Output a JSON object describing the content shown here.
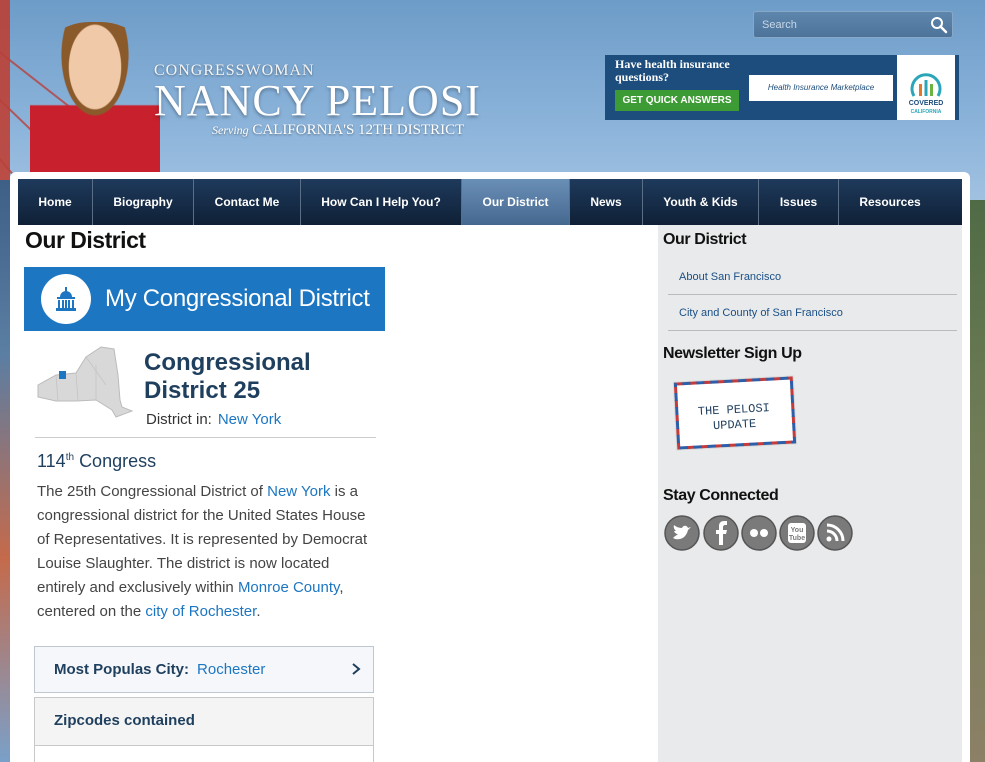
{
  "header": {
    "title_small": "CONGRESSWOMAN",
    "title_big": "NANCY PELOSI",
    "serving": "Serving",
    "district_line": "CALIFORNIA'S 12TH DISTRICT",
    "search_placeholder": "Search"
  },
  "banner": {
    "question": "Have health insurance questions?",
    "cta": "GET QUICK ANSWERS",
    "marketplace": "Health Insurance Marketplace",
    "covered_1": "COVERED",
    "covered_2": "CALIFORNIA"
  },
  "nav": [
    {
      "label": "Home"
    },
    {
      "label": "Biography"
    },
    {
      "label": "Contact Me"
    },
    {
      "label": "How Can I Help You?"
    },
    {
      "label": "Our District"
    },
    {
      "label": "News"
    },
    {
      "label": "Youth & Kids"
    },
    {
      "label": "Issues"
    },
    {
      "label": "Resources"
    }
  ],
  "main": {
    "page_title": "Our District",
    "header_label": "My Congressional District",
    "cd_title": "Congressional District 25",
    "district_in_label": "District in:",
    "district_in_value": "New York",
    "congress_num": "114",
    "congress_sup": "th",
    "congress_word": "Congress",
    "desc": {
      "p1": "The 25th Congressional District of ",
      "link1": "New York",
      "p2": " is a congressional district for the United States House of Representatives. It is represented by Democrat Louise Slaughter. The district is now located entirely and exclusively within ",
      "link2": "Monroe County",
      "p3": ", centered on the ",
      "link3": "city of Rochester",
      "p4": "."
    },
    "popcity_label": "Most Populas City:",
    "popcity_value": "Rochester",
    "zipcodes_label": "Zipcodes contained"
  },
  "sidebar": {
    "our_district": "Our District",
    "links": [
      "About San Francisco",
      "City and County of San Francisco"
    ],
    "newsletter": "Newsletter Sign Up",
    "stamp_line1": "THE PELOSI",
    "stamp_line2": "UPDATE",
    "stay_connected": "Stay Connected",
    "social": [
      "twitter-icon",
      "facebook-icon",
      "flickr-icon",
      "youtube-icon",
      "rss-icon"
    ]
  },
  "colors": {
    "accent": "#1c76c2",
    "nav_dark": "#0f2036",
    "nav_active": "#45688f"
  }
}
